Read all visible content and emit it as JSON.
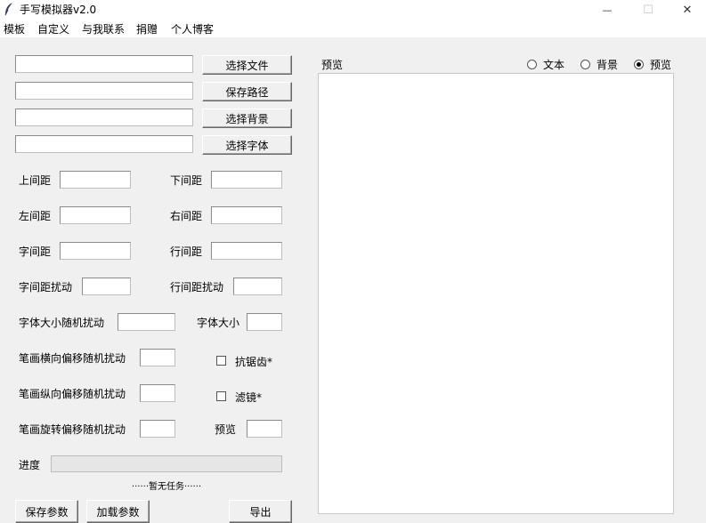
{
  "window": {
    "title": "手写模拟器v2.0",
    "min_glyph": "—",
    "max_glyph": "☐",
    "close_glyph": "✕"
  },
  "menu": [
    "模板",
    "自定义",
    "与我联系",
    "捐赠",
    "个人博客"
  ],
  "file_rows": [
    {
      "value": "",
      "button": "选择文件"
    },
    {
      "value": "",
      "button": "保存路径"
    },
    {
      "value": "",
      "button": "选择背景"
    },
    {
      "value": "",
      "button": "选择字体"
    }
  ],
  "params": {
    "top_margin": "上间距",
    "bottom_margin": "下间距",
    "left_margin": "左间距",
    "right_margin": "右间距",
    "char_spacing": "字间距",
    "line_spacing": "行间距",
    "char_spacing_jitter": "字间距扰动",
    "line_spacing_jitter": "行间距扰动",
    "font_size_jitter": "字体大小随机扰动",
    "font_size": "字体大小",
    "stroke_h_jitter": "笔画横向偏移随机扰动",
    "stroke_v_jitter": "笔画纵向偏移随机扰动",
    "stroke_rot_jitter": "笔画旋转偏移随机扰动",
    "preview_field": "预览"
  },
  "checkboxes": {
    "antialias": {
      "label": "抗锯齿*",
      "checked": false
    },
    "filter": {
      "label": "滤镜*",
      "checked": false
    }
  },
  "progress": {
    "label": "进度",
    "value": 0,
    "status": "······暂无任务······"
  },
  "buttons": {
    "save_params": "保存参数",
    "load_params": "加载参数",
    "export": "导出"
  },
  "preview_panel": {
    "title": "预览",
    "radios": [
      {
        "label": "文本",
        "selected": false
      },
      {
        "label": "背景",
        "selected": false
      },
      {
        "label": "预览",
        "selected": true
      }
    ]
  }
}
